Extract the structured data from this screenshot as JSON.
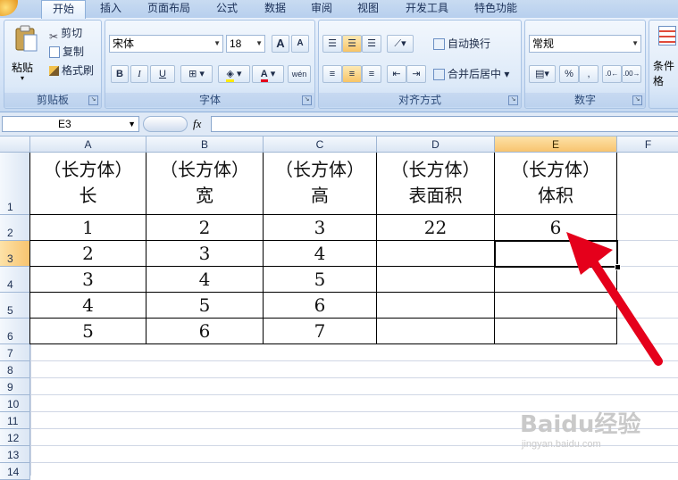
{
  "tabs": [
    "开始",
    "插入",
    "页面布局",
    "公式",
    "数据",
    "审阅",
    "视图",
    "开发工具",
    "特色功能"
  ],
  "clipboard": {
    "paste": "粘贴",
    "cut": "剪切",
    "copy": "复制",
    "format_painter": "格式刷",
    "label": "剪贴板"
  },
  "font": {
    "name": "宋体",
    "size": "18",
    "bold": "B",
    "italic": "I",
    "underline": "U",
    "label": "字体",
    "grow": "A",
    "shrink": "A"
  },
  "alignment": {
    "wrap_text": "自动换行",
    "merge_center": "合并后居中",
    "label": "对齐方式"
  },
  "number": {
    "format": "常规",
    "percent": "%",
    "comma": ",",
    "label": "数字"
  },
  "styles": {
    "conditional": "条件格"
  },
  "formula_bar": {
    "name_box": "E3",
    "fx": "fx",
    "value": ""
  },
  "columns": [
    "A",
    "B",
    "C",
    "D",
    "E",
    "F"
  ],
  "selected_column": "E",
  "rows": [
    "1",
    "2",
    "3",
    "4",
    "5",
    "6",
    "7",
    "8",
    "9",
    "10",
    "11",
    "12",
    "13",
    "14"
  ],
  "selected_row": "3",
  "table": [
    [
      "（长方体）\n长",
      "（长方体）\n宽",
      "（长方体）\n高",
      "（长方体）\n表面积",
      "（长方体）\n体积"
    ],
    [
      "1",
      "2",
      "3",
      "22",
      "6"
    ],
    [
      "2",
      "3",
      "4",
      "",
      ""
    ],
    [
      "3",
      "4",
      "5",
      "",
      ""
    ],
    [
      "4",
      "5",
      "6",
      "",
      ""
    ],
    [
      "5",
      "6",
      "7",
      "",
      ""
    ]
  ],
  "active_cell": "E3",
  "watermark": {
    "brand": "Baidu经验",
    "url": "jingyan.baidu.com"
  },
  "colors": {
    "accent": "#e5001b",
    "ribbon": "#d2e2f6",
    "select": "#f8c46f"
  }
}
